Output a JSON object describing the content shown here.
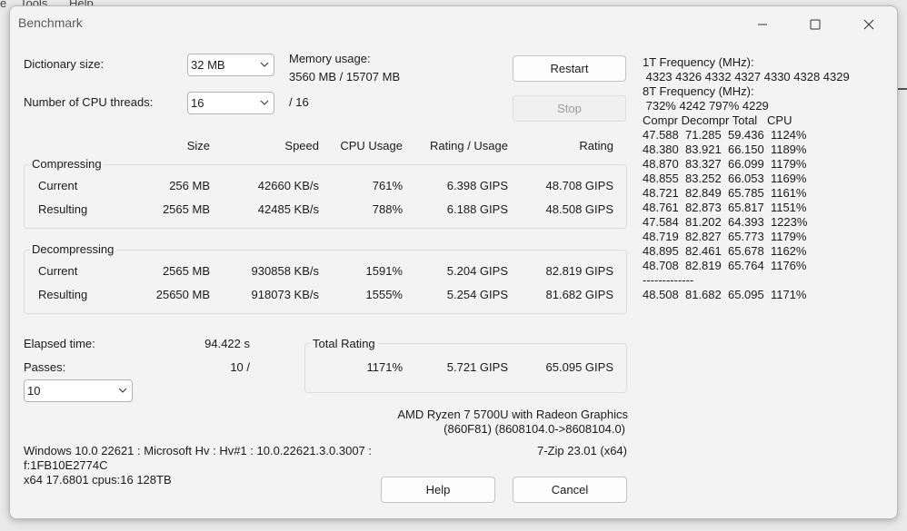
{
  "background_menu": {
    "item1": "e",
    "item2": "Tools",
    "item3": "Help"
  },
  "window": {
    "title": "Benchmark",
    "minimize_glyph": "─",
    "maximize_glyph": "☐",
    "close_glyph": "✕"
  },
  "settings": {
    "dict_label": "Dictionary size:",
    "dict_value": "32 MB",
    "threads_label": "Number of CPU threads:",
    "threads_value": "16",
    "threads_max": "/ 16",
    "memory_label": "Memory usage:",
    "memory_value": "3560 MB / 15707 MB"
  },
  "buttons": {
    "restart": "Restart",
    "stop": "Stop",
    "help": "Help",
    "cancel": "Cancel"
  },
  "headers": {
    "size": "Size",
    "speed": "Speed",
    "cpu": "CPU Usage",
    "rating_usage": "Rating / Usage",
    "rating": "Rating"
  },
  "compressing": {
    "title": "Compressing",
    "rows": [
      {
        "label": "Current",
        "size": "256 MB",
        "speed": "42660 KB/s",
        "cpu": "761%",
        "rpu": "6.398 GIPS",
        "rating": "48.708 GIPS"
      },
      {
        "label": "Resulting",
        "size": "2565 MB",
        "speed": "42485 KB/s",
        "cpu": "788%",
        "rpu": "6.188 GIPS",
        "rating": "48.508 GIPS"
      }
    ]
  },
  "decompressing": {
    "title": "Decompressing",
    "rows": [
      {
        "label": "Current",
        "size": "2565 MB",
        "speed": "930858 KB/s",
        "cpu": "1591%",
        "rpu": "5.204 GIPS",
        "rating": "82.819 GIPS"
      },
      {
        "label": "Resulting",
        "size": "25650 MB",
        "speed": "918073 KB/s",
        "cpu": "1555%",
        "rpu": "5.254 GIPS",
        "rating": "81.682 GIPS"
      }
    ]
  },
  "elapsed": {
    "label": "Elapsed time:",
    "value": "94.422 s"
  },
  "passes": {
    "label": "Passes:",
    "value": "10 /",
    "combo_value": "10"
  },
  "total": {
    "title": "Total Rating",
    "cpu": "1171%",
    "rpu": "5.721 GIPS",
    "rating": "65.095 GIPS"
  },
  "cpu_info": {
    "line1": "AMD Ryzen 7 5700U with Radeon Graphics",
    "line2": "(860F81) (8608104.0->8608104.0)"
  },
  "sys_info": {
    "line1": "Windows 10.0 22621 : Microsoft Hv : Hv#1 : 10.0.22621.3.0.3007 :",
    "line2": "f:1FB10E2774C",
    "line3": "x64 17.6801 cpus:16 128TB"
  },
  "version": "7-Zip 23.01 (x64)",
  "results_log": [
    "1T Frequency (MHz):",
    " 4323 4326 4332 4327 4330 4328 4329",
    "8T Frequency (MHz):",
    " 732% 4242 797% 4229",
    "Compr Decompr Total   CPU",
    "47.588  71.285  59.436  1124%",
    "48.380  83.921  66.150  1189%",
    "48.870  83.327  66.099  1179%",
    "48.855  83.252  66.053  1169%",
    "48.721  82.849  65.785  1161%",
    "48.761  82.873  65.817  1151%",
    "47.584  81.202  64.393  1223%",
    "48.719  82.827  65.773  1179%",
    "48.895  82.461  65.678  1162%",
    "48.708  82.819  65.764  1176%",
    "-------------",
    "48.508  81.682  65.095  1171%"
  ]
}
